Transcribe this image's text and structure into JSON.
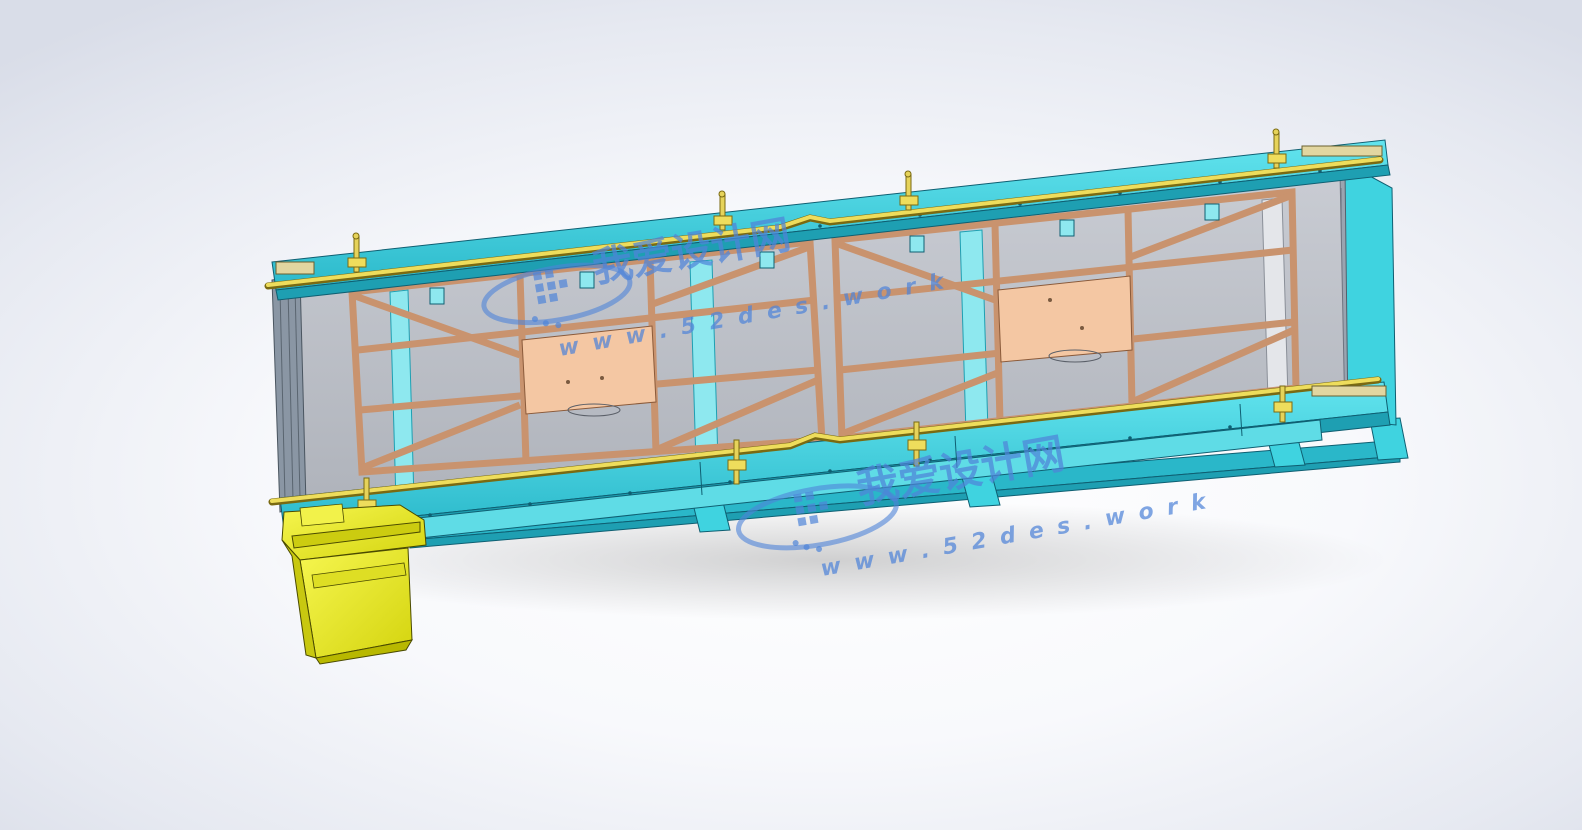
{
  "scene": {
    "background_top": "#d9dde8",
    "background_center": "#ffffff"
  },
  "model": {
    "colors": {
      "frame": "#3fd3e0",
      "frame_dark": "#1e9fb2",
      "frame_edge": "#0f5f72",
      "rail": "#e6d35a",
      "rail_edge": "#7a6a12",
      "truss": "#e8b48a",
      "truss_edge": "#8a5a3a",
      "plate": "#f4c7a3",
      "panel": "#b8bcc4",
      "motor": "#eeee2a",
      "motor_edge": "#4a4a00"
    },
    "icons": [
      "3d-conveyor-model",
      "drive-motor-icon",
      "watermark-logo-icon"
    ]
  },
  "watermarks": [
    {
      "domain": "www.52des.work",
      "brand": "我爱设计网"
    },
    {
      "domain": "www.52des.work",
      "brand": "我爱设计网"
    }
  ],
  "watermark_labels": {
    "wm1_url": "w w w . 5 2 d e s . w o r k",
    "wm1_short": "52des.work",
    "wm2_url": "w w w . 5 2 d e s . w o r k",
    "wm2_short": "52des.work"
  }
}
